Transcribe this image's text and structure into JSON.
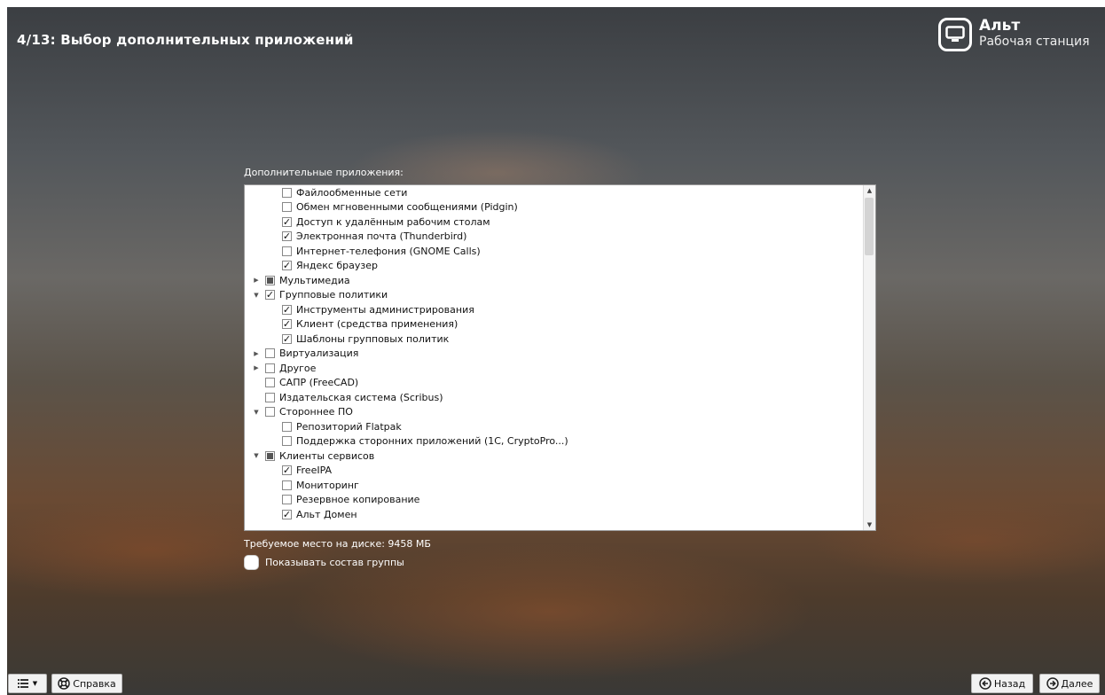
{
  "header": {
    "step_title": "4/13: Выбор дополнительных приложений"
  },
  "brand": {
    "name": "Альт",
    "subtitle": "Рабочая станция",
    "logo_icon": "monitor-icon"
  },
  "apps": {
    "section_label": "Дополнительные приложения:",
    "items": [
      {
        "label": "Файлообменные сети",
        "level": 1,
        "expander": "none",
        "state": "unchecked"
      },
      {
        "label": "Обмен мгновенными сообщениями (Pidgin)",
        "level": 1,
        "expander": "none",
        "state": "unchecked"
      },
      {
        "label": "Доступ к удалённым рабочим столам",
        "level": 1,
        "expander": "none",
        "state": "checked"
      },
      {
        "label": "Электронная почта (Thunderbird)",
        "level": 1,
        "expander": "none",
        "state": "checked"
      },
      {
        "label": "Интернет-телефония (GNOME Calls)",
        "level": 1,
        "expander": "none",
        "state": "unchecked"
      },
      {
        "label": "Яндекс браузер",
        "level": 1,
        "expander": "none",
        "state": "checked"
      },
      {
        "label": "Мультимедиа",
        "level": 0,
        "expander": "collapsed",
        "state": "partial"
      },
      {
        "label": "Групповые политики",
        "level": 0,
        "expander": "expanded",
        "state": "checked"
      },
      {
        "label": "Инструменты администрирования",
        "level": 1,
        "expander": "none",
        "state": "checked"
      },
      {
        "label": "Клиент (средства применения)",
        "level": 1,
        "expander": "none",
        "state": "checked"
      },
      {
        "label": "Шаблоны групповых политик",
        "level": 1,
        "expander": "none",
        "state": "checked"
      },
      {
        "label": "Виртуализация",
        "level": 0,
        "expander": "collapsed",
        "state": "unchecked"
      },
      {
        "label": "Другое",
        "level": 0,
        "expander": "collapsed",
        "state": "unchecked"
      },
      {
        "label": "САПР (FreeCAD)",
        "level": 0,
        "expander": "none",
        "state": "unchecked"
      },
      {
        "label": "Издательская система (Scribus)",
        "level": 0,
        "expander": "none",
        "state": "unchecked"
      },
      {
        "label": "Стороннее ПО",
        "level": 0,
        "expander": "expanded",
        "state": "unchecked"
      },
      {
        "label": "Репозиторий Flatpak",
        "level": 1,
        "expander": "none",
        "state": "unchecked"
      },
      {
        "label": "Поддержка сторонних приложений (1C, CryptoPro...)",
        "level": 1,
        "expander": "none",
        "state": "unchecked"
      },
      {
        "label": "Клиенты сервисов",
        "level": 0,
        "expander": "expanded",
        "state": "partial"
      },
      {
        "label": "FreeIPA",
        "level": 1,
        "expander": "none",
        "state": "checked"
      },
      {
        "label": "Мониторинг",
        "level": 1,
        "expander": "none",
        "state": "unchecked"
      },
      {
        "label": "Резервное копирование",
        "level": 1,
        "expander": "none",
        "state": "unchecked"
      },
      {
        "label": "Альт Домен",
        "level": 1,
        "expander": "none",
        "state": "checked"
      }
    ]
  },
  "disk_space": "Требуемое место на диске: 9458 МБ",
  "show_group_toggle": {
    "label": "Показывать состав группы",
    "checked": false
  },
  "footer": {
    "menu_icon": "list-menu-icon",
    "help_label": "Справка",
    "back_label": "Назад",
    "next_label": "Далее"
  }
}
